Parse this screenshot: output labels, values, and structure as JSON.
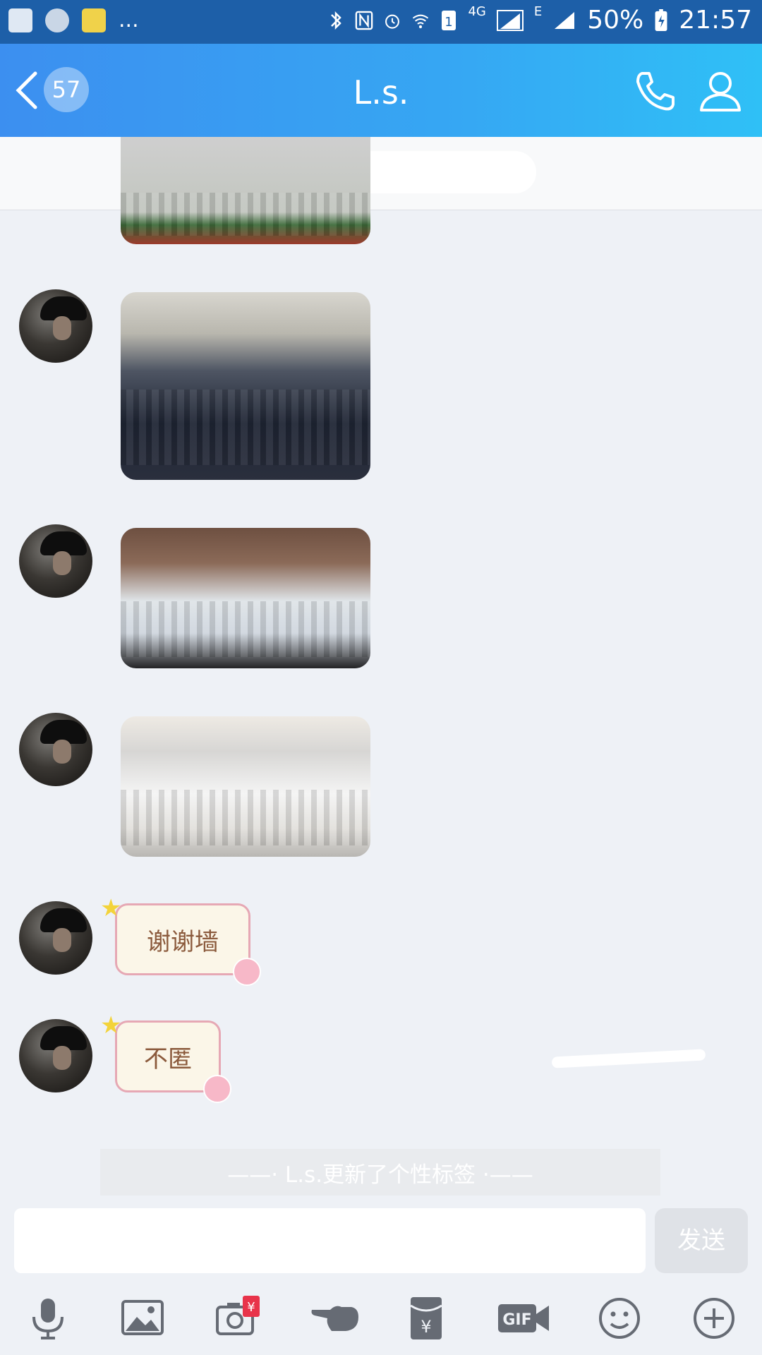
{
  "statusbar": {
    "overflow": "...",
    "net_4g": "4G",
    "net_e": "E",
    "battery": "50%",
    "time": "21:57"
  },
  "header": {
    "unread_count": "57",
    "title": "L.s."
  },
  "messages": {
    "sticker1_text": "谢谢墙",
    "sticker2_text": "不匿"
  },
  "system_notice": "——· L.s.更新了个性标签 ·——",
  "composer": {
    "input_value": "",
    "send_label": "发送"
  },
  "toolbar": {
    "gif_label": "GIF",
    "icons": [
      "microphone-icon",
      "image-icon",
      "camera-icon",
      "poke-icon",
      "red-packet-icon",
      "gif-icon",
      "emoji-icon",
      "plus-icon"
    ]
  },
  "colors": {
    "header_start": "#3c8ff0",
    "header_end": "#2fc0f6",
    "statusbar": "#1d5fa8",
    "chat_bg": "#eef1f6",
    "icon_gray": "#666b74",
    "red_badge": "#e8334a"
  }
}
